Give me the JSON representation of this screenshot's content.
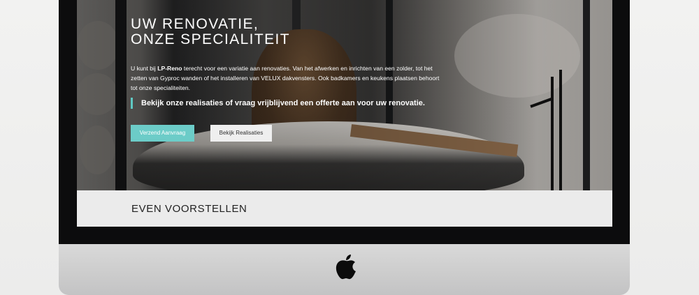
{
  "hero": {
    "title_line1": "UW RENOVATIE,",
    "title_line2": "ONZE SPECIALITEIT",
    "desc_prefix": "U kunt bij ",
    "desc_brand": "LP-Reno",
    "desc_suffix": " terecht voor een variatie aan renovaties. Van het afwerken en inrichten van een zolder, tot het zetten van Gyproc wanden of het installeren van VELUX dakvensters. Ook badkamers en keukens plaatsen behoort tot onze specialiteiten.",
    "quote": "Bekijk onze realisaties of vraag vrijblijvend een offerte aan voor uw renovatie.",
    "primary_button": "Verzend Aanvraag",
    "secondary_button": "Bekijk Realisaties"
  },
  "intro": {
    "title": "EVEN VOORSTELLEN"
  },
  "colors": {
    "accent": "#6cccc8",
    "quote_border": "#5fc8c2",
    "intro_bg": "#ebebeb"
  },
  "icons": {
    "monitor_logo": "apple-logo-icon"
  }
}
